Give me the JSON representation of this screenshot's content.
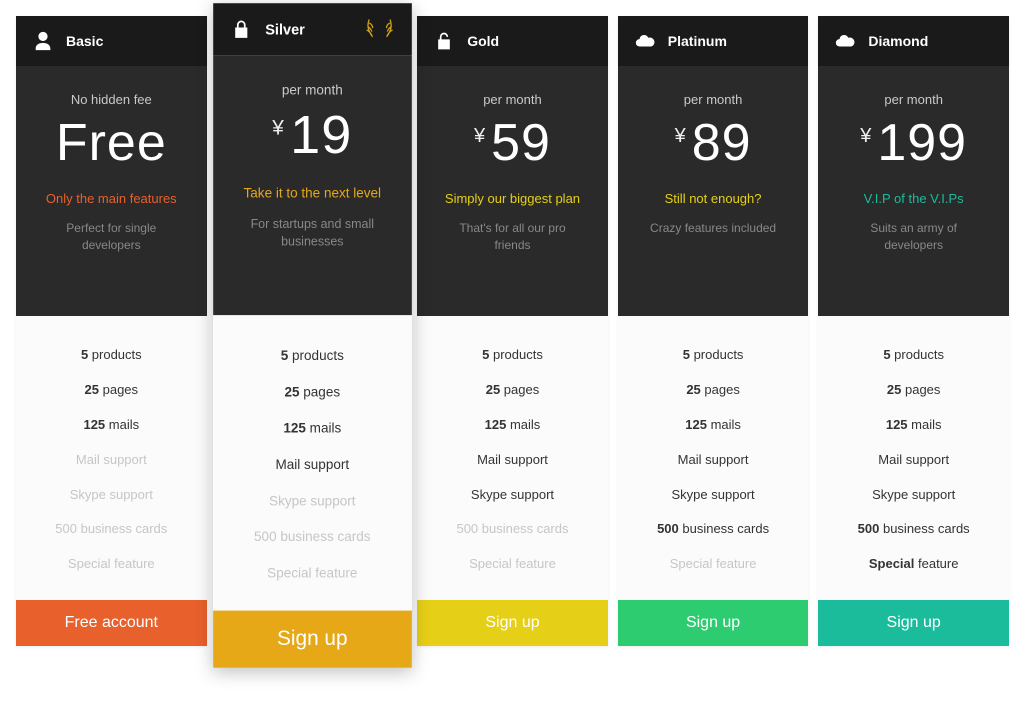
{
  "colors": {
    "orange": "#e8602c",
    "amber": "#e6a817",
    "yellow": "#e6cf17",
    "green": "#2ecc71",
    "teal": "#1abc9c"
  },
  "plans": [
    {
      "id": "basic",
      "icon": "person-icon",
      "title": "Basic",
      "price_label": "No hidden fee",
      "currency": "",
      "price": "Free",
      "tagline": "Only the main features",
      "tagline_color": "#e8602c",
      "subtext": "Perfect for single developers",
      "cta": "Free account",
      "cta_color": "#e8602c",
      "featured": false,
      "features": [
        {
          "bold": "5",
          "rest": " products",
          "enabled": true
        },
        {
          "bold": "25",
          "rest": " pages",
          "enabled": true
        },
        {
          "bold": "125",
          "rest": " mails",
          "enabled": true
        },
        {
          "bold": "",
          "rest": "Mail support",
          "enabled": false
        },
        {
          "bold": "",
          "rest": "Skype support",
          "enabled": false
        },
        {
          "bold": "",
          "rest": "500 business cards",
          "enabled": false
        },
        {
          "bold": "",
          "rest": "Special feature",
          "enabled": false
        }
      ]
    },
    {
      "id": "silver",
      "icon": "lock-icon",
      "title": "Silver",
      "badge": "laurel-icon",
      "price_label": "per month",
      "currency": "¥",
      "price": "19",
      "tagline": "Take it to the next level",
      "tagline_color": "#e6a817",
      "subtext": "For startups and small businesses",
      "cta": "Sign up",
      "cta_color": "#e6a817",
      "featured": true,
      "features": [
        {
          "bold": "5",
          "rest": " products",
          "enabled": true
        },
        {
          "bold": "25",
          "rest": " pages",
          "enabled": true
        },
        {
          "bold": "125",
          "rest": " mails",
          "enabled": true
        },
        {
          "bold": "",
          "rest": "Mail support",
          "enabled": true
        },
        {
          "bold": "",
          "rest": "Skype support",
          "enabled": false
        },
        {
          "bold": "",
          "rest": "500 business cards",
          "enabled": false
        },
        {
          "bold": "",
          "rest": "Special feature",
          "enabled": false
        }
      ]
    },
    {
      "id": "gold",
      "icon": "lock-open-icon",
      "title": "Gold",
      "price_label": "per month",
      "currency": "¥",
      "price": "59",
      "tagline": "Simply our biggest plan",
      "tagline_color": "#e6cf17",
      "subtext": "That's for all our pro friends",
      "cta": "Sign up",
      "cta_color": "#e6cf17",
      "featured": false,
      "features": [
        {
          "bold": "5",
          "rest": " products",
          "enabled": true
        },
        {
          "bold": "25",
          "rest": " pages",
          "enabled": true
        },
        {
          "bold": "125",
          "rest": " mails",
          "enabled": true
        },
        {
          "bold": "",
          "rest": "Mail support",
          "enabled": true
        },
        {
          "bold": "",
          "rest": "Skype support",
          "enabled": true
        },
        {
          "bold": "",
          "rest": "500 business cards",
          "enabled": false
        },
        {
          "bold": "",
          "rest": "Special feature",
          "enabled": false
        }
      ]
    },
    {
      "id": "platinum",
      "icon": "cloud-icon",
      "title": "Platinum",
      "price_label": "per month",
      "currency": "¥",
      "price": "89",
      "tagline": "Still not enough?",
      "tagline_color": "#e6cf17",
      "subtext": "Crazy features included",
      "cta": "Sign up",
      "cta_color": "#2ecc71",
      "featured": false,
      "features": [
        {
          "bold": "5",
          "rest": " products",
          "enabled": true
        },
        {
          "bold": "25",
          "rest": " pages",
          "enabled": true
        },
        {
          "bold": "125",
          "rest": " mails",
          "enabled": true
        },
        {
          "bold": "",
          "rest": "Mail support",
          "enabled": true
        },
        {
          "bold": "",
          "rest": "Skype support",
          "enabled": true
        },
        {
          "bold": "500",
          "rest": " business cards",
          "enabled": true
        },
        {
          "bold": "",
          "rest": "Special feature",
          "enabled": false
        }
      ]
    },
    {
      "id": "diamond",
      "icon": "cloud-icon",
      "title": "Diamond",
      "price_label": "per month",
      "currency": "¥",
      "price": "199",
      "tagline": "V.I.P of the V.I.Ps",
      "tagline_color": "#1abc9c",
      "subtext": "Suits an army of developers",
      "cta": "Sign up",
      "cta_color": "#1abc9c",
      "featured": false,
      "features": [
        {
          "bold": "5",
          "rest": " products",
          "enabled": true
        },
        {
          "bold": "25",
          "rest": " pages",
          "enabled": true
        },
        {
          "bold": "125",
          "rest": " mails",
          "enabled": true
        },
        {
          "bold": "",
          "rest": "Mail support",
          "enabled": true
        },
        {
          "bold": "",
          "rest": "Skype support",
          "enabled": true
        },
        {
          "bold": "500",
          "rest": " business cards",
          "enabled": true
        },
        {
          "bold": "Special",
          "rest": " feature",
          "enabled": true
        }
      ]
    }
  ]
}
